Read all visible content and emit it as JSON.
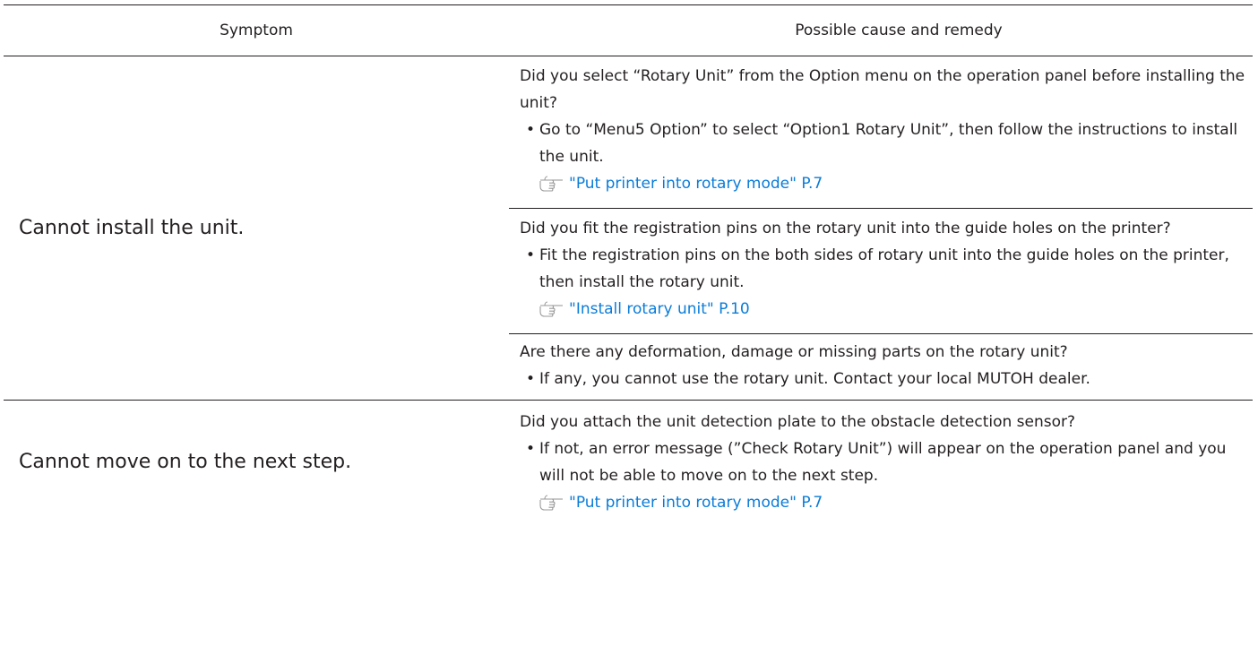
{
  "header": {
    "symptom": "Symptom",
    "remedy": "Possible cause and remedy"
  },
  "rows": [
    {
      "symptom": "Cannot install the unit.",
      "causes": [
        {
          "question": "Did you select “Rotary Unit” from the Option menu on the operation panel before installing the unit?",
          "remedy": "Go to “Menu5 Option” to select “Option1 Rotary Unit”, then follow the instructions to install the unit.",
          "reference": "\"Put printer into rotary mode\" P.7"
        },
        {
          "question": "Did you fit the registration pins on the rotary unit into the guide holes on the printer?",
          "remedy": "Fit the registration pins on the both sides of rotary unit into the guide holes on the printer, then install the rotary unit.",
          "reference": "\"Install rotary unit\" P.10"
        },
        {
          "question": "Are there any deformation, damage or missing parts on the rotary unit?",
          "remedy": "If any, you cannot use the rotary unit. Contact your local MUTOH dealer."
        }
      ]
    },
    {
      "symptom": "Cannot move on to the next step.",
      "causes": [
        {
          "question": "Did you attach the unit detection plate to the obstacle detection sensor?",
          "remedy": "If not, an error message (”Check Rotary Unit”) will appear on the operation panel and you will not be able to move on to the next step.",
          "reference": "\"Put printer into rotary mode\" P.7"
        }
      ]
    }
  ],
  "bullet_char": "•",
  "icons": {
    "reference": "pointing-hand-icon"
  },
  "colors": {
    "text": "#231f20",
    "link": "#0a7cd8",
    "rule": "#231f20"
  }
}
